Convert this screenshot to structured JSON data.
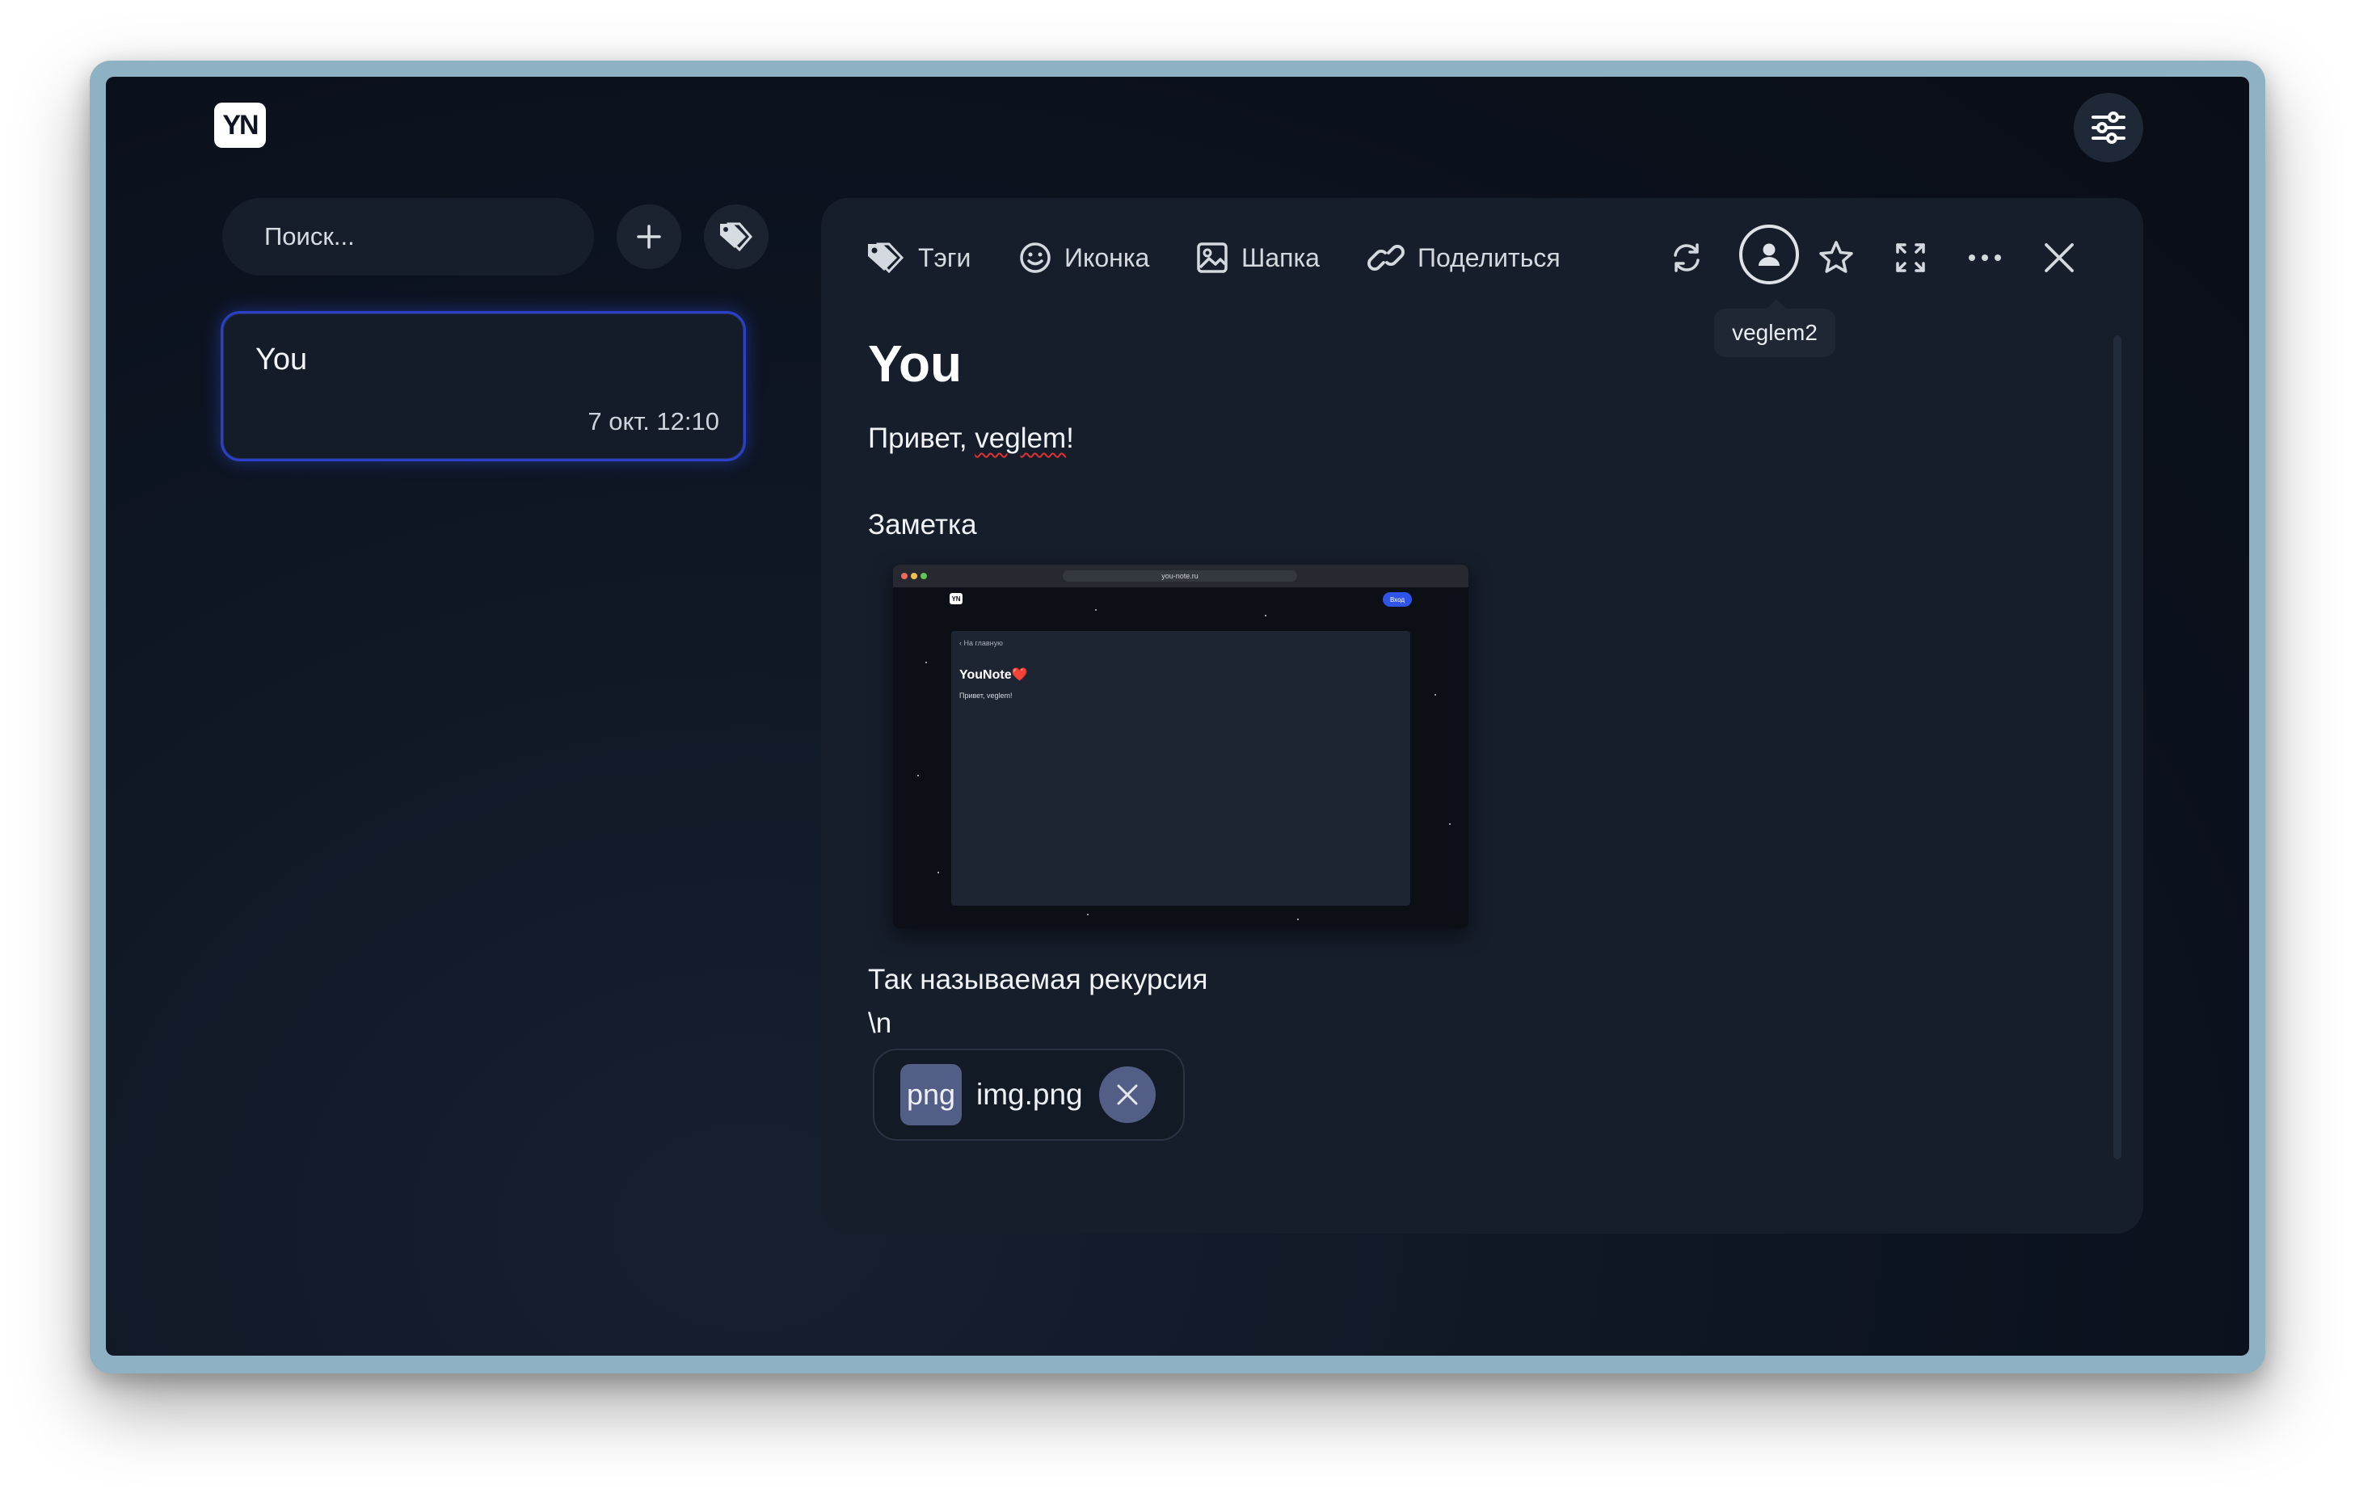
{
  "app": {
    "logo_text": "YN"
  },
  "sidebar": {
    "search": {
      "placeholder": "Поиск..."
    },
    "notes": [
      {
        "title": "You",
        "date": "7 окт. 12:10"
      }
    ]
  },
  "toolbar": {
    "tags_label": "Тэги",
    "icon_label": "Иконка",
    "cover_label": "Шапка",
    "share_label": "Поделиться",
    "user_tooltip": "veglem2"
  },
  "note": {
    "title": "You",
    "greeting_prefix": "Привет, ",
    "greeting_name": "veglem",
    "greeting_suffix": "!",
    "section": "Заметка",
    "caption": "Так называемая рекурсия",
    "raw_line": "\\n",
    "attachment": {
      "ext": "png",
      "name": "img.png"
    }
  },
  "embedded_screenshot": {
    "url": "you-note.ru",
    "logo_text": "YN",
    "login_label": "Вход",
    "back_link": "‹ На главную",
    "title": "YouNote❤️",
    "text": "Привет, veglem!"
  },
  "icons": {
    "settings": "sliders-icon",
    "search": "search-icon",
    "add": "plus-icon",
    "tags": "tags-icon",
    "tag": "tag-icon",
    "smile": "smile-icon",
    "image": "image-icon",
    "link": "link-icon",
    "sync": "sync-icon",
    "user": "user-circle-icon",
    "star": "star-icon",
    "expand": "expand-icon",
    "more": "more-icon",
    "close": "close-icon"
  },
  "colors": {
    "accent": "#2b40c8",
    "background": "#0d1421",
    "panel": "#161e2b",
    "chip": "#535e86"
  }
}
